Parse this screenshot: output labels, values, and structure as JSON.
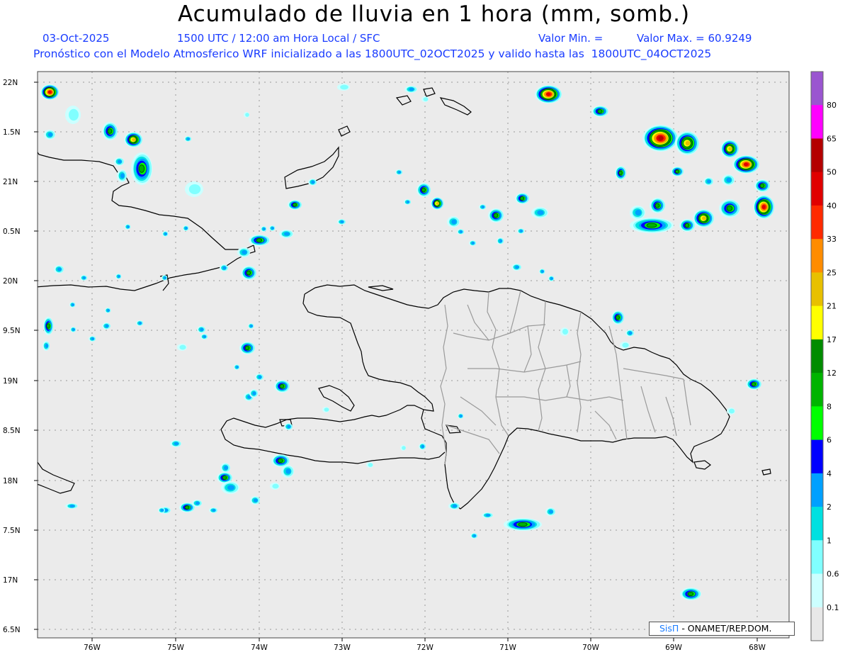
{
  "title": "Acumulado de lluvia en 1 hora (mm, somb.)",
  "header": {
    "date": "03-Oct-2025",
    "time": "1500 UTC / 12:00 am Hora Local / SFC",
    "min_label": "Valor Min. =",
    "max_label": "Valor Max. = 60.9249",
    "model_line": "Pronóstico con el Modelo Atmosferico WRF inicializado a las 1800UTC_02OCT2025 y valido hasta las  1800UTC_04OCT2025"
  },
  "axes": {
    "lat_ticks": [
      "22N",
      "1.5N",
      "21N",
      "0.5N",
      "20N",
      "9.5N",
      "19N",
      "8.5N",
      "18N",
      "7.5N",
      "17N",
      "6.5N"
    ],
    "lon_ticks": [
      "76W",
      "75W",
      "74W",
      "73W",
      "72W",
      "71W",
      "70W",
      "69W",
      "68W"
    ]
  },
  "colorbar": {
    "labels": [
      "80",
      "65",
      "50",
      "40",
      "33",
      "25",
      "21",
      "17",
      "12",
      "8",
      "6",
      "4",
      "2",
      "1",
      "0.6",
      "0.1"
    ],
    "colors": [
      "#9a55d0",
      "#ff00ff",
      "#b40000",
      "#e00000",
      "#ff2a00",
      "#ff8c00",
      "#e8c000",
      "#ffff00",
      "#008c00",
      "#00b400",
      "#00ff00",
      "#0000ff",
      "#00a0ff",
      "#00e0e0",
      "#80ffff",
      "#ccffff",
      "#e8e8e8"
    ]
  },
  "credit": {
    "brand": "SisΠ",
    "org": "- ONAMET/REP.DOM."
  }
}
